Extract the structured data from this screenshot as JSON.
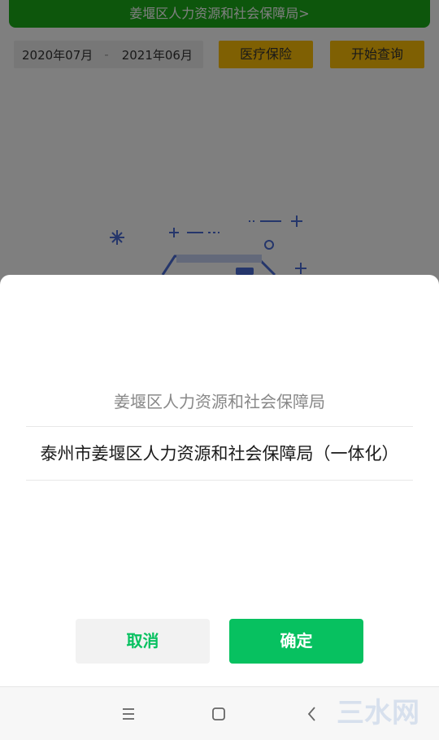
{
  "header": {
    "bureau_link": "姜堰区人力资源和社会保障局>"
  },
  "filters": {
    "date_start": "2020年07月",
    "date_separator": "-",
    "date_end": "2021年06月",
    "insurance_type": "医疗保险",
    "query_button": "开始查询"
  },
  "picker": {
    "title": "姜堰区人力资源和社会保障局",
    "options": [
      "泰州市姜堰区人力资源和社会保障局（一体化）"
    ],
    "cancel_label": "取消",
    "confirm_label": "确定"
  },
  "watermark": "三水网",
  "colors": {
    "primary_green": "#07c160",
    "header_green": "#1aad19",
    "accent_yellow": "#ffc107",
    "illustration_blue": "#4a6cd6"
  }
}
